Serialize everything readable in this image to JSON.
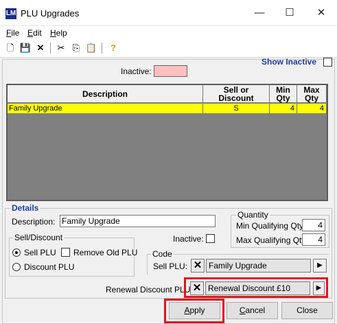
{
  "window": {
    "title": "PLU Upgrades",
    "icon_text": "LM",
    "controls": {
      "minimize": "—",
      "maximize": "☐",
      "close": "✕"
    }
  },
  "menu": [
    {
      "label": "File",
      "mnemonic": "F",
      "rest": "ile"
    },
    {
      "label": "Edit",
      "mnemonic": "E",
      "rest": "dit"
    },
    {
      "label": "Help",
      "mnemonic": "H",
      "rest": "elp"
    }
  ],
  "toolbar": {
    "icons": [
      "new-icon",
      "save-icon",
      "delete-icon",
      "cut-icon",
      "copy-icon",
      "paste-icon",
      "help-icon"
    ],
    "glyphs": {
      "new": "🗋",
      "save": "💾",
      "delete": "✕",
      "cut": "✂",
      "copy": "⎘",
      "paste": "📋",
      "help": "?"
    }
  },
  "show_inactive": {
    "label": "Show Inactive",
    "checked": false
  },
  "inactive_legend": {
    "label": "Inactive:",
    "color": "#ffc0c0"
  },
  "table": {
    "columns": [
      {
        "line1": "Description",
        "line2": ""
      },
      {
        "line1": "Sell or",
        "line2": "Discount"
      },
      {
        "line1": "Min",
        "line2": "Qty"
      },
      {
        "line1": "Max",
        "line2": "Qty"
      }
    ],
    "rows": [
      {
        "description": "Family Upgrade",
        "sell_or_discount": "S",
        "min_qty": "4",
        "max_qty": "4",
        "selected": true
      }
    ],
    "highlight_color": "#ffff00"
  },
  "details": {
    "section_label": "Details",
    "description_label": "Description:",
    "description_value": "Family Upgrade",
    "inactive_label": "Inactive:",
    "inactive_checked": false,
    "quantity": {
      "group_label": "Quantity",
      "min_label": "Min Qualifying Qty:",
      "min_value": "4",
      "max_label": "Max Qualifying Qty:",
      "max_value": "4"
    },
    "sell_discount": {
      "group_label": "Sell/Discount",
      "sell_plu": "Sell PLU",
      "discount_plu": "Discount PLU",
      "remove_old_plu": "Remove Old PLU",
      "selected": "Sell PLU",
      "remove_old_checked": false
    },
    "code": {
      "group_label": "Code",
      "sell_plu_label": "Sell PLU:",
      "sell_plu_value": "Family Upgrade"
    },
    "renewal": {
      "label": "Renewal Discount PLU:",
      "value": "Renewal Discount £10"
    },
    "clear_glyph": "✕",
    "arrow_glyph": "▶"
  },
  "buttons": {
    "apply": {
      "label": "Apply",
      "mnemonic": "A",
      "rest": "pply"
    },
    "cancel": {
      "label": "Cancel",
      "mnemonic": "C",
      "rest": "ancel"
    },
    "close": {
      "label": "Close"
    }
  },
  "highlight_color": "#e0151f"
}
